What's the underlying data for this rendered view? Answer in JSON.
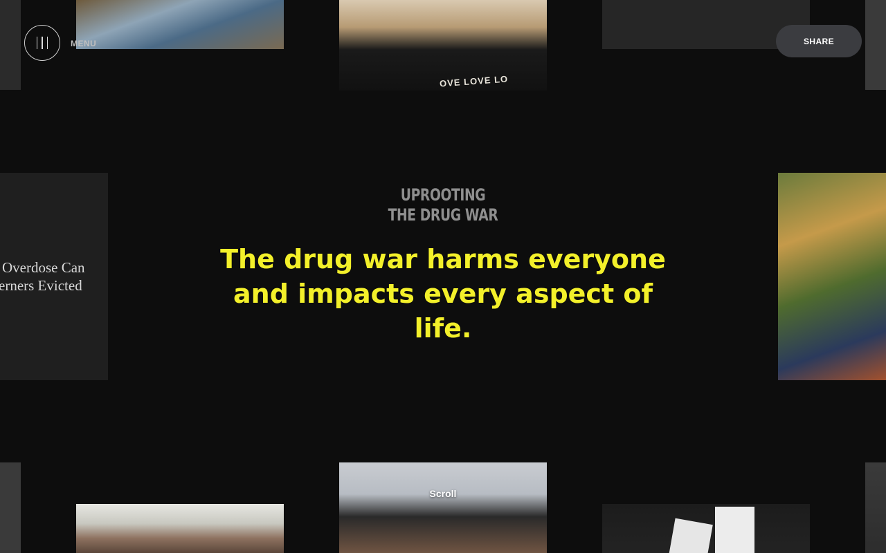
{
  "header": {
    "menu_label": "MENU",
    "share_label": "SHARE"
  },
  "logo": {
    "line1": "UPROOTING",
    "line2": "THE DRUG WAR"
  },
  "hero": {
    "headline": "The drug war harms everyone and impacts every aspect of life."
  },
  "tiles": {
    "article_left": {
      "line1": "Overdose Can",
      "line2": "erners Evicted"
    },
    "shirt_text": "OVE LOVE LO"
  },
  "footer": {
    "scroll_label": "Scroll"
  },
  "colors": {
    "background": "#0d0d0d",
    "headline": "#f3f02a",
    "share_button": "#3b3c40"
  }
}
